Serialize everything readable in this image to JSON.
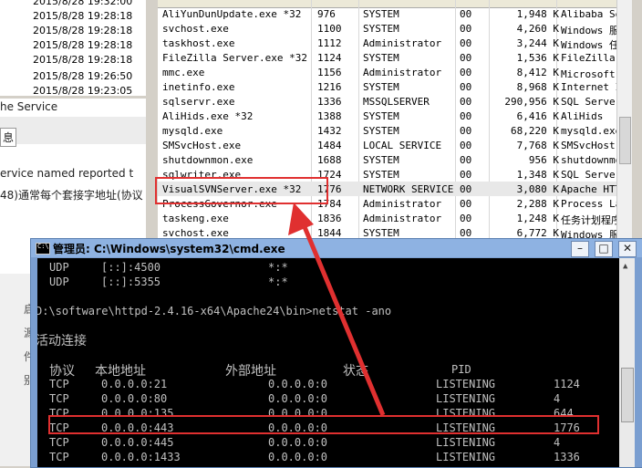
{
  "left_panel": {
    "dates": [
      "2015/8/28 19:32:00",
      "2015/8/28 19:28:18",
      "2015/8/28 19:28:18",
      "2015/8/28 19:28:18",
      "2015/8/28 19:28:18",
      "2015/8/28 19:26:50",
      "2015/8/28 19:23:05"
    ],
    "service_label": "he Service",
    "tab_char": "息",
    "service_named_text": "ervice named  reported t",
    "chinese_text": "48)通常每个套接字地址(协议",
    "side_chars": [
      "启",
      "源",
      "件",
      "别"
    ]
  },
  "task_manager": {
    "header": {
      "name": "映像名称",
      "pid": "PID",
      "user": "用户名",
      "cpu": "CPU",
      "mem": "内存(...",
      "desc": "描述"
    },
    "rows": [
      {
        "name": "AliYunDunUpdate.exe *32",
        "pid": "976",
        "user": "SYSTEM",
        "cpu": "00",
        "mem": "1,948 K",
        "desc": "Alibaba Secu"
      },
      {
        "name": "svchost.exe",
        "pid": "1100",
        "user": "SYSTEM",
        "cpu": "00",
        "mem": "4,260 K",
        "desc": "Windows 服务"
      },
      {
        "name": "taskhost.exe",
        "pid": "1112",
        "user": "Administrator",
        "cpu": "00",
        "mem": "3,244 K",
        "desc": "Windows 任务"
      },
      {
        "name": "FileZilla Server.exe *32",
        "pid": "1124",
        "user": "SYSTEM",
        "cpu": "00",
        "mem": "1,536 K",
        "desc": "FileZilla Se"
      },
      {
        "name": "mmc.exe",
        "pid": "1156",
        "user": "Administrator",
        "cpu": "00",
        "mem": "8,412 K",
        "desc": "Microsoft 管"
      },
      {
        "name": "inetinfo.exe",
        "pid": "1216",
        "user": "SYSTEM",
        "cpu": "00",
        "mem": "8,968 K",
        "desc": "Internet Inf"
      },
      {
        "name": "sqlservr.exe",
        "pid": "1336",
        "user": "MSSQLSERVER",
        "cpu": "00",
        "mem": "290,956 K",
        "desc": "SQL Server W"
      },
      {
        "name": "AliHids.exe *32",
        "pid": "1388",
        "user": "SYSTEM",
        "cpu": "00",
        "mem": "6,416 K",
        "desc": "AliHids"
      },
      {
        "name": "mysqld.exe",
        "pid": "1432",
        "user": "SYSTEM",
        "cpu": "00",
        "mem": "68,220 K",
        "desc": "mysqld.exe"
      },
      {
        "name": "SMSvcHost.exe",
        "pid": "1484",
        "user": "LOCAL SERVICE",
        "cpu": "00",
        "mem": "7,768 K",
        "desc": "SMSvcHost.ex"
      },
      {
        "name": "shutdownmon.exe",
        "pid": "1688",
        "user": "SYSTEM",
        "cpu": "00",
        "mem": "956 K",
        "desc": "shutdownmon."
      },
      {
        "name": "sqlwriter.exe",
        "pid": "1724",
        "user": "SYSTEM",
        "cpu": "00",
        "mem": "1,348 K",
        "desc": "SQL Server V"
      },
      {
        "name": "VisualSVNServer.exe *32",
        "pid": "1776",
        "user": "NETWORK SERVICE",
        "cpu": "00",
        "mem": "3,080 K",
        "desc": "Apache HTTP"
      },
      {
        "name": "ProcessGovernor.exe",
        "pid": "1784",
        "user": "Administrator",
        "cpu": "00",
        "mem": "2,288 K",
        "desc": "Process Lass"
      },
      {
        "name": "taskeng.exe",
        "pid": "1836",
        "user": "Administrator",
        "cpu": "00",
        "mem": "1,248 K",
        "desc": "任务计划程序"
      },
      {
        "name": "svchost.exe",
        "pid": "1844",
        "user": "SYSTEM",
        "cpu": "00",
        "mem": "6,772 K",
        "desc": "Windows 服务"
      }
    ]
  },
  "cmd": {
    "title": "管理员: C:\\Windows\\system32\\cmd.exe",
    "min": "–",
    "max": "□",
    "close": "✕",
    "udp_rows": [
      {
        "proto": "UDP",
        "local": "[::]:4500",
        "foreign": "*:*"
      },
      {
        "proto": "UDP",
        "local": "[::]:5355",
        "foreign": "*:*"
      }
    ],
    "prompt": "D:\\software\\httpd-2.4.16-x64\\Apache24\\bin>netstat -ano",
    "active_connections": "活动连接",
    "headers": {
      "proto": "协议",
      "local": "本地地址",
      "foreign": "外部地址",
      "state": "状态",
      "pid": "PID"
    },
    "tcp_rows": [
      {
        "proto": "TCP",
        "local": "0.0.0.0:21",
        "foreign": "0.0.0.0:0",
        "state": "LISTENING",
        "pid": "1124"
      },
      {
        "proto": "TCP",
        "local": "0.0.0.0:80",
        "foreign": "0.0.0.0:0",
        "state": "LISTENING",
        "pid": "4"
      },
      {
        "proto": "TCP",
        "local": "0.0.0.0:135",
        "foreign": "0.0.0.0:0",
        "state": "LISTENING",
        "pid": "644"
      },
      {
        "proto": "TCP",
        "local": "0.0.0.0:443",
        "foreign": "0.0.0.0:0",
        "state": "LISTENING",
        "pid": "1776"
      },
      {
        "proto": "TCP",
        "local": "0.0.0.0:445",
        "foreign": "0.0.0.0:0",
        "state": "LISTENING",
        "pid": "4"
      },
      {
        "proto": "TCP",
        "local": "0.0.0.0:1433",
        "foreign": "0.0.0.0:0",
        "state": "LISTENING",
        "pid": "1336"
      }
    ]
  },
  "colors": {
    "highlight": "#e03030",
    "console_bg": "#000000",
    "console_text": "#c0c0c0",
    "title_bar": "#8eb2e2"
  }
}
